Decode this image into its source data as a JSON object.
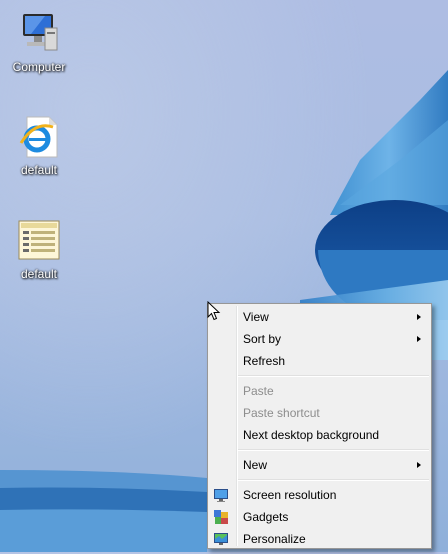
{
  "desktop": {
    "icons": [
      {
        "label": "Computer",
        "icon": "computer-icon"
      },
      {
        "label": "default",
        "icon": "internet-explorer-icon"
      },
      {
        "label": "default",
        "icon": "document-icon"
      }
    ]
  },
  "context_menu": {
    "items": [
      {
        "label": "View",
        "submenu": true,
        "enabled": true
      },
      {
        "label": "Sort by",
        "submenu": true,
        "enabled": true
      },
      {
        "label": "Refresh",
        "submenu": false,
        "enabled": true
      },
      {
        "label": "Paste",
        "submenu": false,
        "enabled": false
      },
      {
        "label": "Paste shortcut",
        "submenu": false,
        "enabled": false
      },
      {
        "label": "Next desktop background",
        "submenu": false,
        "enabled": true
      },
      {
        "label": "New",
        "submenu": true,
        "enabled": true
      },
      {
        "label": "Screen resolution",
        "icon": "screen-resolution-icon",
        "enabled": true
      },
      {
        "label": "Gadgets",
        "icon": "gadgets-icon",
        "enabled": true
      },
      {
        "label": "Personalize",
        "icon": "personalize-icon",
        "enabled": true
      }
    ]
  }
}
